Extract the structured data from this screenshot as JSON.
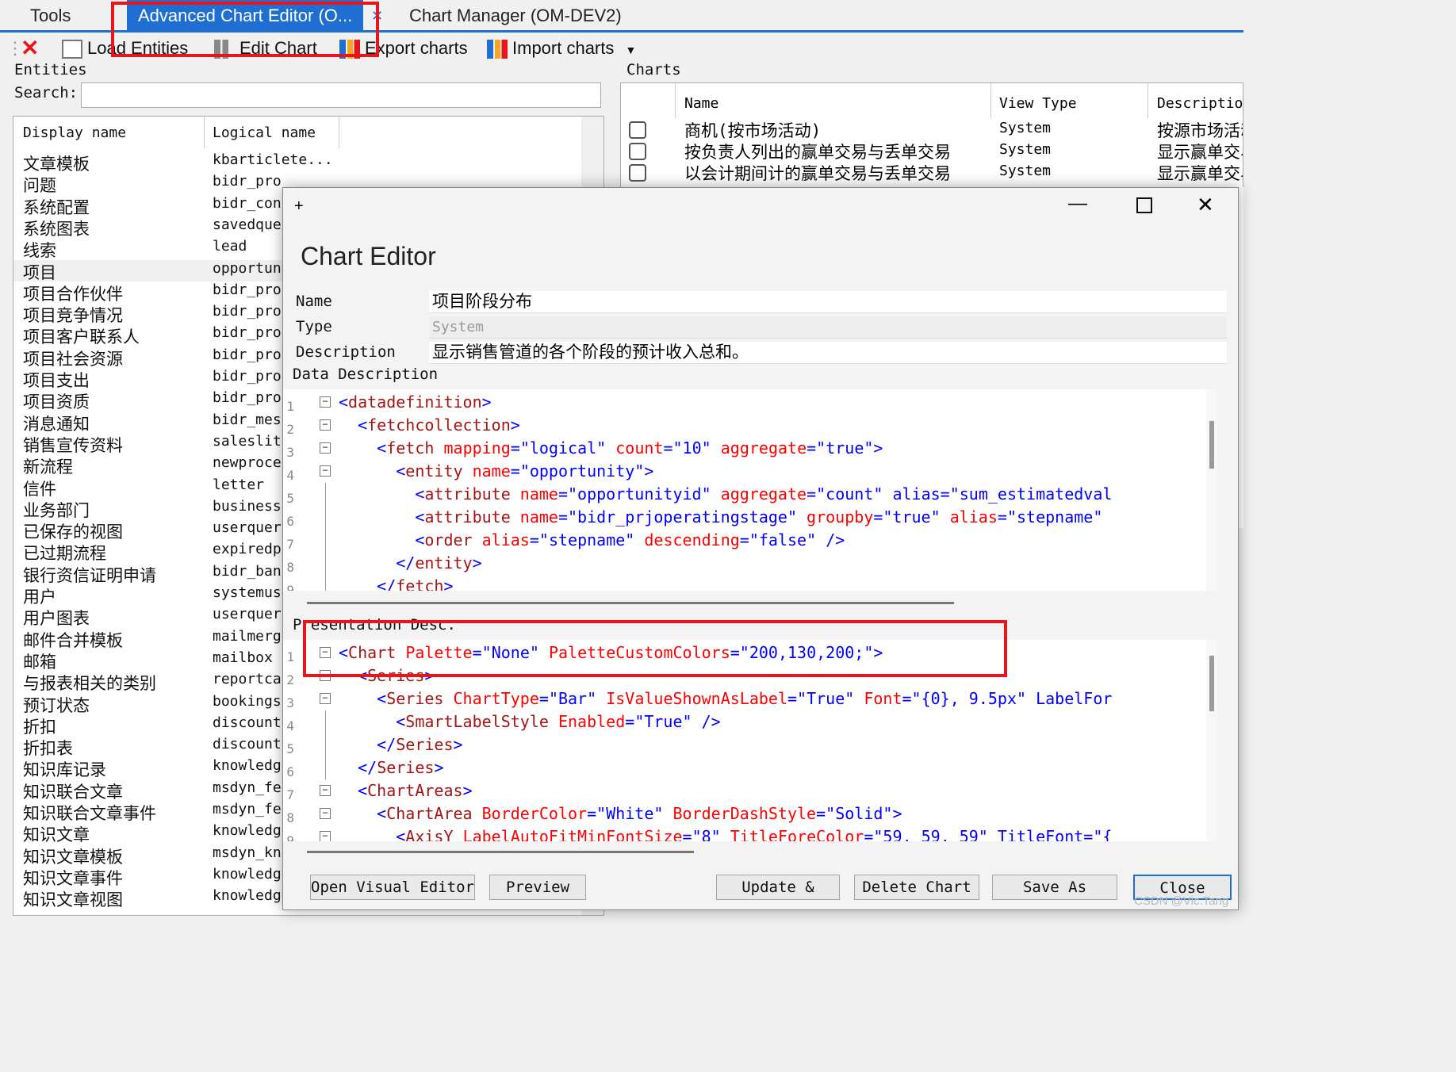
{
  "tabs": [
    {
      "label": "Tools"
    },
    {
      "label": "Advanced Chart Editor (O..."
    },
    {
      "label": "Chart Manager (OM-DEV2)"
    }
  ],
  "toolbar": {
    "load": "Load Entities",
    "edit": "Edit Chart",
    "export": "Export charts",
    "import": "Import charts"
  },
  "entities": {
    "section_label": "Entities",
    "search_label": "Search:",
    "col_display": "Display name",
    "col_logical": "Logical name",
    "rows": [
      {
        "display": "文章模板",
        "logical": "kbarticlete..."
      },
      {
        "display": "问题",
        "logical": "bidr_proissue"
      },
      {
        "display": "系统配置",
        "logical": "bidr_conf"
      },
      {
        "display": "系统图表",
        "logical": "savedquer"
      },
      {
        "display": "线索",
        "logical": "lead"
      },
      {
        "display": "项目",
        "logical": "opportuni"
      },
      {
        "display": "项目合作伙伴",
        "logical": "bidr_proj"
      },
      {
        "display": "项目竞争情况",
        "logical": "bidr_proj"
      },
      {
        "display": "项目客户联系人",
        "logical": "bidr_proj"
      },
      {
        "display": "项目社会资源",
        "logical": "bidr_pros"
      },
      {
        "display": "项目支出",
        "logical": "bidr_proj"
      },
      {
        "display": "项目资质",
        "logical": "bidr_proj"
      },
      {
        "display": "消息通知",
        "logical": "bidr_mess"
      },
      {
        "display": "销售宣传资料",
        "logical": "saleslit"
      },
      {
        "display": "新流程",
        "logical": "newproces"
      },
      {
        "display": "信件",
        "logical": "letter"
      },
      {
        "display": "业务部门",
        "logical": "business"
      },
      {
        "display": "已保存的视图",
        "logical": "userquery"
      },
      {
        "display": "已过期流程",
        "logical": "expiredpr"
      },
      {
        "display": "银行资信证明申请",
        "logical": "bidr_bank"
      },
      {
        "display": "用户",
        "logical": "systemuse"
      },
      {
        "display": "用户图表",
        "logical": "userquery"
      },
      {
        "display": "邮件合并模板",
        "logical": "mailmerge"
      },
      {
        "display": "邮箱",
        "logical": "mailbox"
      },
      {
        "display": "与报表相关的类别",
        "logical": "reportcat"
      },
      {
        "display": "预订状态",
        "logical": "bookings"
      },
      {
        "display": "折扣",
        "logical": "discount"
      },
      {
        "display": "折扣表",
        "logical": "discount"
      },
      {
        "display": "知识库记录",
        "logical": "knowledge"
      },
      {
        "display": "知识联合文章",
        "logical": "msdyn_fed"
      },
      {
        "display": "知识联合文章事件",
        "logical": "msdyn_fed"
      },
      {
        "display": "知识文章",
        "logical": "knowledge"
      },
      {
        "display": "知识文章模板",
        "logical": "msdyn_kno"
      },
      {
        "display": "知识文章事件",
        "logical": "knowledge"
      },
      {
        "display": "知识文章视图",
        "logical": "knowledge"
      }
    ]
  },
  "charts": {
    "section_label": "Charts",
    "col_name": "Name",
    "col_viewtype": "View Type",
    "col_desc": "Description",
    "rows": [
      {
        "name": "商机(按市场活动)",
        "viewtype": "System",
        "desc": "按源市场活动"
      },
      {
        "name": "按负责人列出的赢单交易与丢单交易",
        "viewtype": "System",
        "desc": "显示赢单交易"
      },
      {
        "name": "以会计期间计的赢单交易与丢单交易",
        "viewtype": "System",
        "desc": "显示赢单交易"
      }
    ]
  },
  "dialog": {
    "plus": "+",
    "title": "Chart Editor",
    "name_label": "Name",
    "name_value": "项目阶段分布",
    "type_label": "Type",
    "type_value": "System",
    "desc_label": "Description",
    "desc_value": "显示销售管道的各个阶段的预计收入总和。",
    "data_label": "Data Description",
    "pres_label": "Presentation Desc.",
    "buttons": {
      "open": "Open Visual Editor",
      "preview": "Preview",
      "update": "Update &",
      "delete": "Delete Chart",
      "saveas": "Save As",
      "close": "Close"
    }
  },
  "watermark": "CSDN @Vic.Tang"
}
